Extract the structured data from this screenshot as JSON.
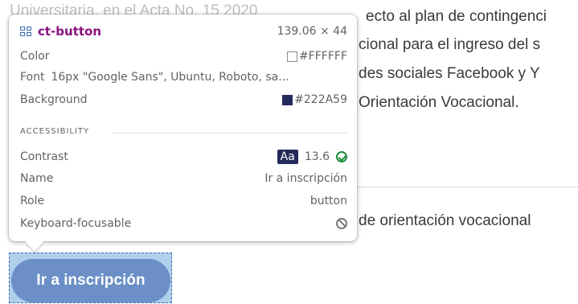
{
  "page": {
    "lines": [
      "Universitaria, en el Acta No. 15 2020",
      "ecto al plan de contingenci",
      "cional para el ingreso del s",
      "des sociales Facebook y Y",
      "Orientación Vocacional.",
      "de orientación vocacional"
    ],
    "button_label": "Ir a inscripción"
  },
  "tooltip": {
    "element": "ct-button",
    "size": "139.06 × 44",
    "color_label": "Color",
    "color_value": "#FFFFFF",
    "font_label": "Font",
    "font_value": "16px \"Google Sans\", Ubuntu, Roboto, sa...",
    "background_label": "Background",
    "background_value": "#222A59",
    "section": "ACCESSIBILITY",
    "contrast_label": "Contrast",
    "contrast_badge": "Aa",
    "contrast_value": "13.6",
    "name_label": "Name",
    "name_value": "Ir a inscripción",
    "role_label": "Role",
    "role_value": "button",
    "keyboard_label": "Keyboard-focusable"
  },
  "colors": {
    "accent_tag": "#881280",
    "button_bg": "#222A59",
    "pass": "#1e8e3e"
  },
  "icons": [
    "element-grid-icon",
    "check-circle-icon",
    "not-allowed-icon"
  ]
}
